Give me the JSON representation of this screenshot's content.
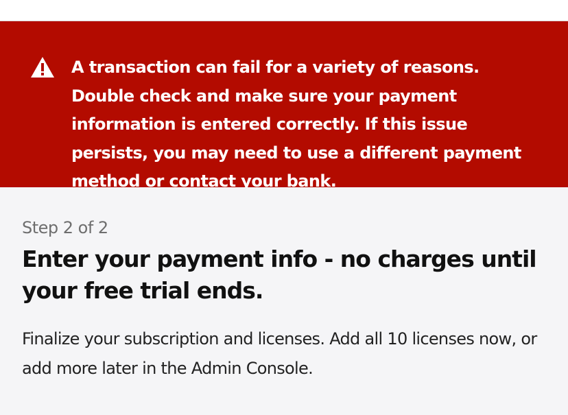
{
  "alert": {
    "icon": "warning-triangle-icon",
    "message": "A transaction can fail for a variety of reasons. Double check and make sure your payment information is entered correctly. If this issue persists, you may need to use a different payment method or contact your bank.",
    "background_color": "#b30b00",
    "text_color": "#ffffff"
  },
  "checkout": {
    "step": "Step 2 of 2",
    "title": "Enter your payment info - no charges until your free trial ends.",
    "description": "Finalize your subscription and licenses. Add all 10 licenses now, or add more later in the Admin Console."
  }
}
